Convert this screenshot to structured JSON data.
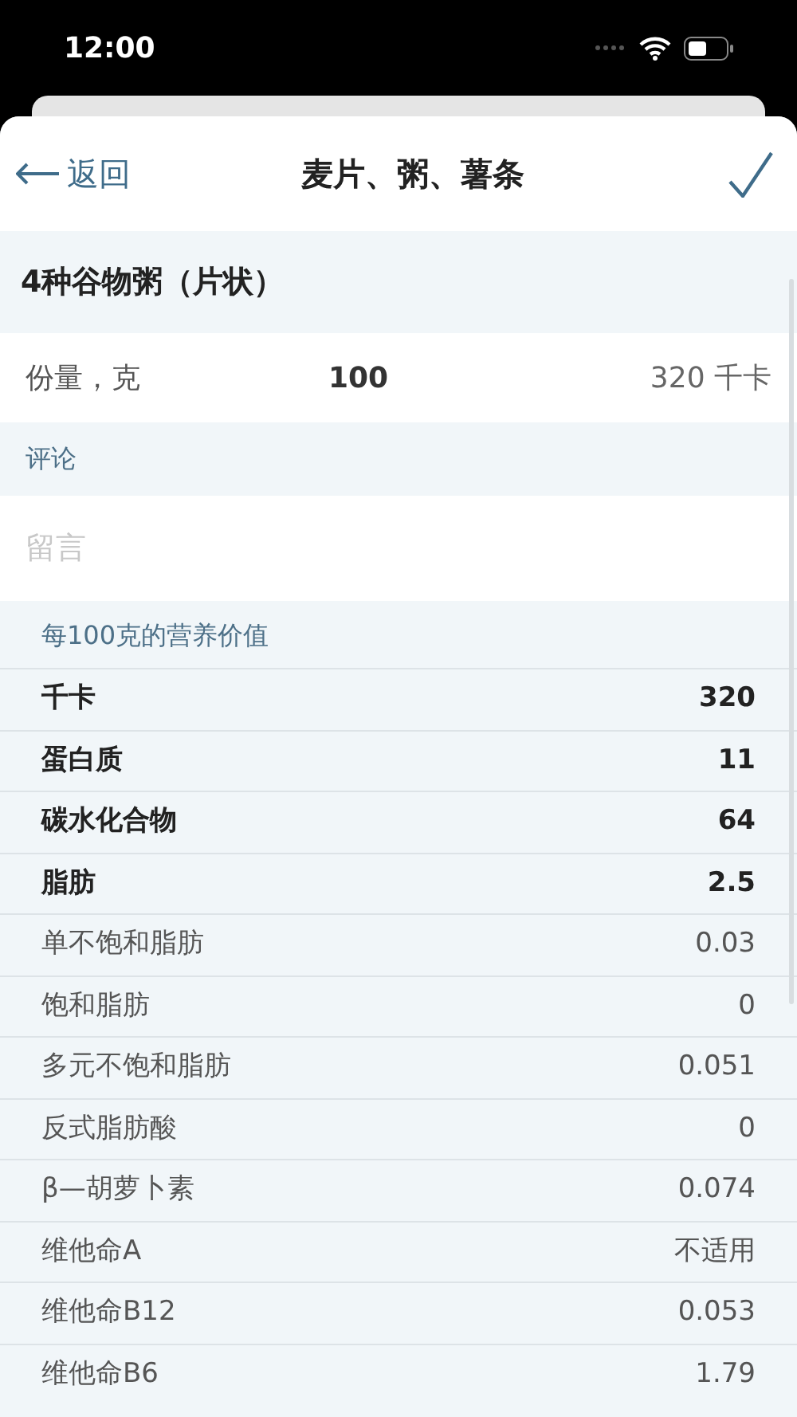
{
  "status_bar": {
    "time": "12:00"
  },
  "nav": {
    "back": "返回",
    "title": "麦片、粥、薯条"
  },
  "food": {
    "name": "4种谷物粥（片状）"
  },
  "portion": {
    "label": "份量，克",
    "value": "100",
    "energy": "320 千卡"
  },
  "comment": {
    "label": "评论",
    "placeholder": "留言"
  },
  "nutrition": {
    "heading": "每100克的营养价值",
    "rows": [
      {
        "kind": "main",
        "name": "千卡",
        "value": "320"
      },
      {
        "kind": "main",
        "name": "蛋白质",
        "value": "11"
      },
      {
        "kind": "main",
        "name": "碳水化合物",
        "value": "64"
      },
      {
        "kind": "main",
        "name": "脂肪",
        "value": "2.5"
      },
      {
        "kind": "sub",
        "name": "单不饱和脂肪",
        "value": "0.03"
      },
      {
        "kind": "sub",
        "name": "饱和脂肪",
        "value": "0"
      },
      {
        "kind": "sub",
        "name": "多元不饱和脂肪",
        "value": "0.051"
      },
      {
        "kind": "sub",
        "name": "反式脂肪酸",
        "value": "0"
      },
      {
        "kind": "sub",
        "name": "β—胡萝卜素",
        "value": "0.074"
      },
      {
        "kind": "sub",
        "name": "维他命A",
        "value": "不适用"
      },
      {
        "kind": "sub",
        "name": "维他命B12",
        "value": "0.053"
      },
      {
        "kind": "sub",
        "name": "维他命B6",
        "value": "1.79"
      }
    ]
  }
}
